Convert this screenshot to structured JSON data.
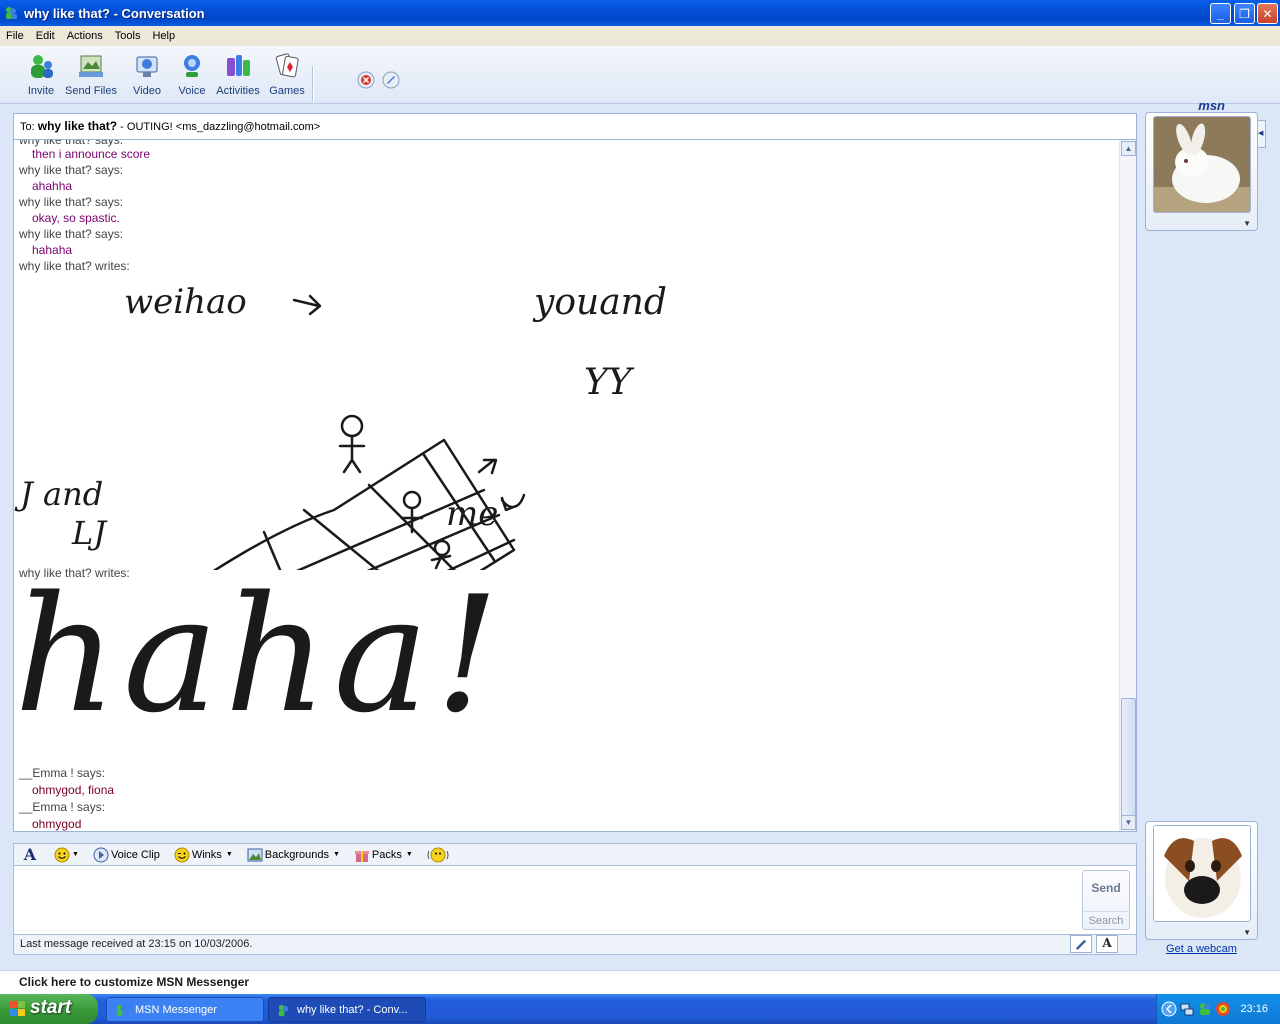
{
  "window": {
    "title": "why like that? - Conversation",
    "controls": {
      "minimize": "_",
      "maximize": "❐",
      "close": "✕"
    }
  },
  "menu": [
    "File",
    "Edit",
    "Actions",
    "Tools",
    "Help"
  ],
  "toolbar": {
    "items": [
      {
        "label": "Invite",
        "icon": "invite-icon"
      },
      {
        "label": "Send Files",
        "icon": "send-files-icon"
      },
      {
        "label": "Video",
        "icon": "video-icon"
      },
      {
        "label": "Voice",
        "icon": "voice-icon"
      },
      {
        "label": "Activities",
        "icon": "activities-icon"
      },
      {
        "label": "Games",
        "icon": "games-icon"
      }
    ],
    "brand": "msn"
  },
  "to_bar": {
    "prefix": "To:",
    "contact_name": "why like that?",
    "contact_rest": " - OUTING! <ms_dazzling@hotmail.com>"
  },
  "conversation": {
    "partial_top": "why like that? says:",
    "m1_text": "then i announce score",
    "m2_head": "why like that? says:",
    "m2_text": "ahahha",
    "m3_head": "why like that? says:",
    "m3_text": "okay, so spastic.",
    "m4_head": "why like that? says:",
    "m4_text": "hahaha",
    "ink1_head": "why like that? writes:",
    "ink1_words": {
      "weihao": "weihao",
      "youand": "youand",
      "yy": "YY",
      "j_and": "J and",
      "lj": "LJ",
      "me": "me"
    },
    "ink2_head": "why like that? writes:",
    "ink2_word": "haha!",
    "m5_head": "__Emma ! says:",
    "m5_text": "ohmygod, fiona",
    "m6_head": "__Emma ! says:",
    "m6_text": "ohmygod"
  },
  "format_bar": {
    "font_glyph": "A",
    "voice_clip": "Voice Clip",
    "winks": "Winks",
    "backgrounds": "Backgrounds",
    "packs": "Packs"
  },
  "input": {
    "value": "",
    "send": "Send",
    "search": "Search"
  },
  "status": {
    "text": "Last message received at 23:15 on 10/03/2006."
  },
  "right_panel": {
    "webcam_link": "Get a webcam"
  },
  "customize": "Click here to customize MSN Messenger",
  "taskbar": {
    "start": "start",
    "tasks": [
      "MSN Messenger",
      "why like that? - Conv..."
    ],
    "clock": "23:16"
  },
  "colors": {
    "title_blue": "#0350d6",
    "msg_purple": "#7a006e",
    "msg_maroon": "#7a0026",
    "start_green": "#3a9b3a"
  }
}
